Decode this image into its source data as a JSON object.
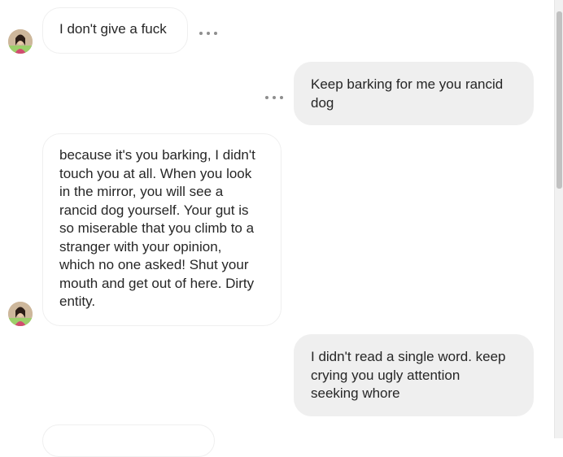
{
  "messages": [
    {
      "direction": "incoming",
      "text": "I don't give a fuck",
      "has_avatar": true,
      "more_icon": "more-horizontal-icon"
    },
    {
      "direction": "outgoing",
      "text": "Keep barking for me you rancid\ndog",
      "more_icon": "more-horizontal-icon"
    },
    {
      "direction": "incoming",
      "text": "because it's you barking, I didn't\ntouch you at all. When you look\nin the mirror, you will see a\nrancid dog yourself. Your gut is\nso miserable that you climb to a\nstranger with your opinion,\nwhich no one asked! Shut your\nmouth and get out of here. Dirty\nentity.",
      "has_avatar": true
    },
    {
      "direction": "outgoing",
      "text": "I didn't read a single word. keep\ncrying you ugly attention\nseeking whore"
    },
    {
      "direction": "incoming",
      "text": ""
    }
  ],
  "colors": {
    "outgoing_bubble": "#efefef",
    "incoming_border": "#efefef",
    "text": "#262626",
    "more_dots": "#8e8e8e"
  }
}
